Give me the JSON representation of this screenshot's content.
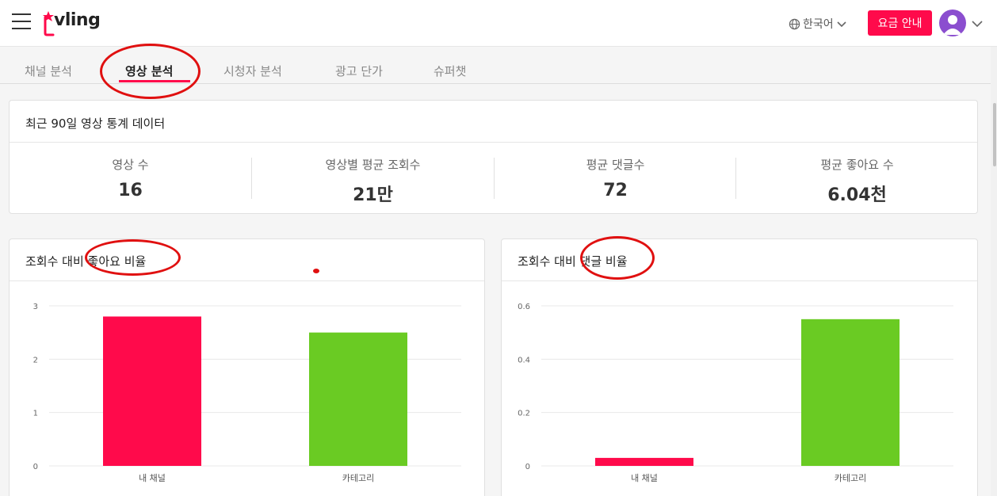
{
  "header": {
    "logo_text": "vling",
    "language": "한국어",
    "pricing_button": "요금 안내"
  },
  "tabs": [
    {
      "label": "채널 분석",
      "active": false
    },
    {
      "label": "영상 분석",
      "active": true
    },
    {
      "label": "시청자 분석",
      "active": false
    },
    {
      "label": "광고 단가",
      "active": false
    },
    {
      "label": "슈퍼챗",
      "active": false
    }
  ],
  "stats_card": {
    "title": "최근 90일 영상 통계 데이터",
    "items": [
      {
        "label": "영상 수",
        "value": "16"
      },
      {
        "label": "영상별 평균 조회수",
        "value": "21만"
      },
      {
        "label": "평균 댓글수",
        "value": "72"
      },
      {
        "label": "평균 좋아요 수",
        "value": "6.04천"
      }
    ]
  },
  "colors": {
    "accent": "#ff0a4b",
    "my_channel_bar": "#ff0a4b",
    "category_bar": "#6acb23",
    "annotation": "#e01010"
  },
  "chart_data": [
    {
      "type": "bar",
      "title": "조회수 대비 좋아요 비율",
      "categories": [
        "내 채널",
        "카테고리"
      ],
      "values": [
        2.8,
        2.5
      ],
      "bar_colors": [
        "#ff0a4b",
        "#6acb23"
      ],
      "yticks": [
        "0",
        "1",
        "2",
        "3"
      ],
      "ylim": [
        0,
        3
      ],
      "grid": true
    },
    {
      "type": "bar",
      "title": "조회수 대비 댓글 비율",
      "categories": [
        "내 채널",
        "카테고리"
      ],
      "values": [
        0.03,
        0.55
      ],
      "bar_colors": [
        "#ff0a4b",
        "#6acb23"
      ],
      "yticks": [
        "0",
        "0.2",
        "0.4",
        "0.6"
      ],
      "ylim": [
        0,
        0.6
      ],
      "grid": true
    }
  ]
}
